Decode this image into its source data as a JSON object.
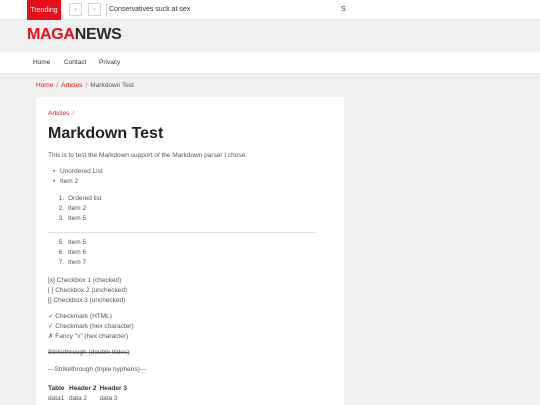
{
  "topbar": {
    "trending_label": "Trending",
    "prev_glyph": "‹",
    "next_glyph": "›",
    "headline": "Conservatives suck at sex",
    "search_glyph": "S"
  },
  "logo": {
    "part1": "MAGA",
    "part2": "NEWS"
  },
  "nav": {
    "items": [
      "Home",
      "Contact",
      "Privacy"
    ]
  },
  "breadcrumb": {
    "home": "Home",
    "articles": "Articles",
    "current": "Markdown Test",
    "sep": "/"
  },
  "article": {
    "category": "Articles",
    "category_sep": "/",
    "title": "Markdown Test",
    "intro": "This is to test the Markdown support of the Markdown parser I chose.",
    "unordered": [
      "Unordered List",
      "Item 2"
    ],
    "ordered1": [
      {
        "num": "1.",
        "text": "Ordered list"
      },
      {
        "num": "2.",
        "text": "Item 2"
      },
      {
        "num": "3.",
        "text": "Item 5"
      }
    ],
    "ordered2": [
      {
        "num": "5.",
        "text": "Item 5"
      },
      {
        "num": "6.",
        "text": "Item 6"
      },
      {
        "num": "7.",
        "text": "Item 7"
      }
    ],
    "checkboxes": [
      "[x] Checkbox 1 (checked)",
      "[ ] Checkbox 2 (unchecked)",
      "[] Checkbox 3 (unchecked)"
    ],
    "marks": [
      "✓ Checkmark (HTML)",
      "✓ Checkmark (hex character)",
      "✗ Fancy \"x\" (hex character)"
    ],
    "strike1": "Strikethrough (double tildes)",
    "strike2": "---Strikethrough (triple hyphens)---",
    "table": {
      "headers": [
        "Table",
        "Header 2",
        "Header 3"
      ],
      "rows": [
        [
          "data1",
          "data 2",
          "data 3"
        ]
      ]
    }
  }
}
